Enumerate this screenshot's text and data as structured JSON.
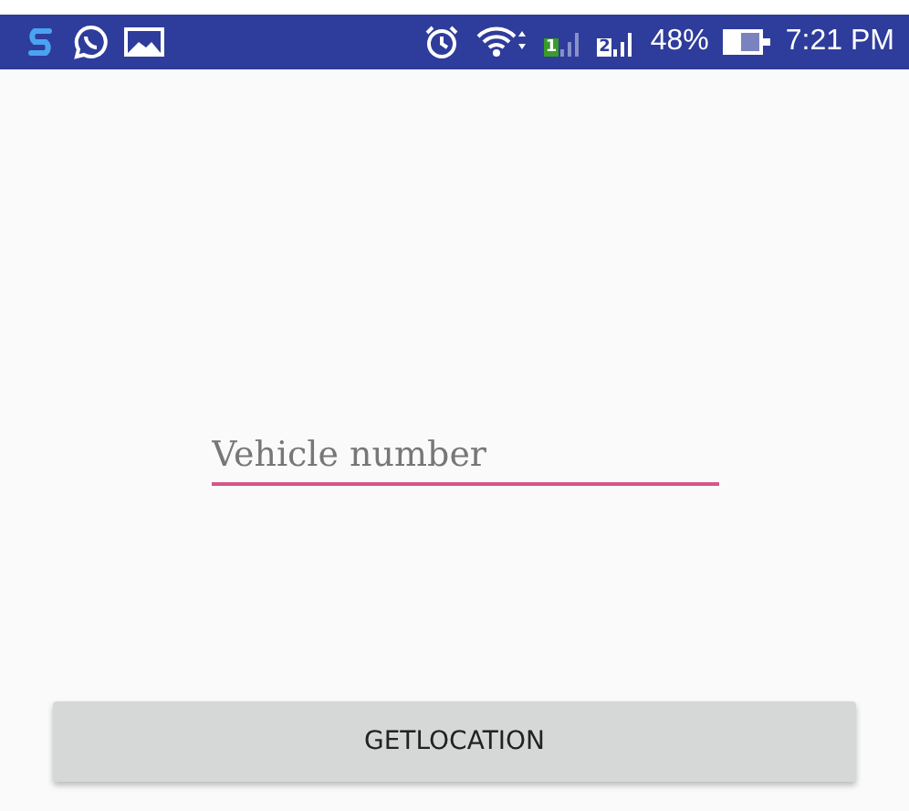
{
  "status_bar": {
    "sim_1": "1",
    "sim_2": "2",
    "battery": "48%",
    "time": "7:21 PM"
  },
  "vehicle_field": {
    "placeholder": "Vehicle number"
  },
  "buttons": [
    {
      "label": "GETLOCATION"
    }
  ]
}
